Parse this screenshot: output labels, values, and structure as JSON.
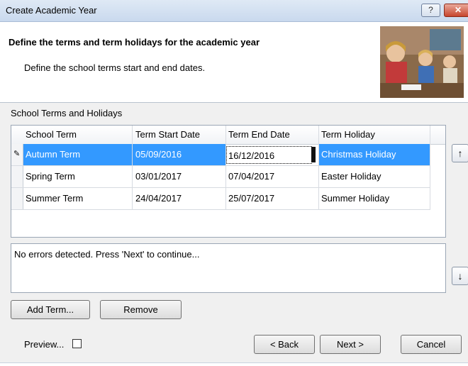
{
  "window": {
    "title": "Create Academic Year",
    "help_glyph": "?",
    "close_glyph": "✕"
  },
  "header": {
    "title": "Define the terms and term holidays for the academic year",
    "subtitle": "Define the school terms start and end dates."
  },
  "section": {
    "label": "School Terms and Holidays"
  },
  "grid": {
    "columns": [
      "School Term",
      "Term Start Date",
      "Term End Date",
      "Term Holiday"
    ],
    "rows": [
      {
        "term": "Autumn Term",
        "start": "05/09/2016",
        "end": "16/12/2016",
        "holiday": "Christmas Holiday",
        "selected": true,
        "editing": "end"
      },
      {
        "term": "Spring Term",
        "start": "03/01/2017",
        "end": "07/04/2017",
        "holiday": "Easter Holiday",
        "selected": false
      },
      {
        "term": "Summer Term",
        "start": "24/04/2017",
        "end": "25/07/2017",
        "holiday": "Summer Holiday",
        "selected": false
      }
    ],
    "row_indicator": "✎"
  },
  "side_buttons": {
    "up_glyph": "↑",
    "down_glyph": "↓"
  },
  "status": {
    "message": "No errors detected. Press 'Next' to continue..."
  },
  "buttons": {
    "add_term": "Add Term...",
    "remove": "Remove",
    "back": "< Back",
    "next": "Next >",
    "cancel": "Cancel"
  },
  "preview": {
    "label": "Preview...",
    "checked": false
  },
  "colors": {
    "selection": "#3399ff",
    "titlebar": "#c9d9ee"
  }
}
